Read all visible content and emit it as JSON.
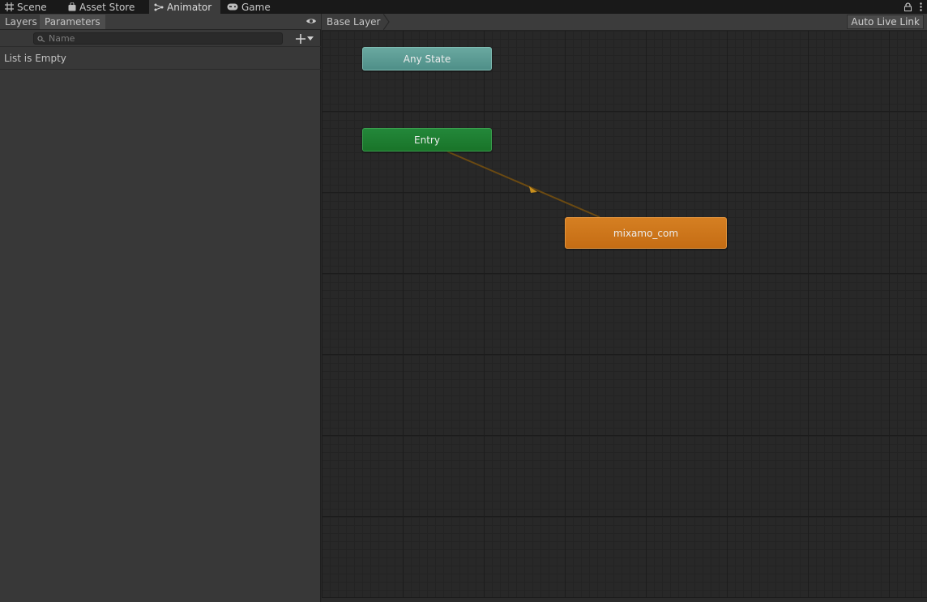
{
  "tabs": [
    {
      "label": "Scene",
      "icon": "grid-icon"
    },
    {
      "label": "Asset Store",
      "icon": "bag-icon"
    },
    {
      "label": "Animator",
      "icon": "animator-icon",
      "active": true
    },
    {
      "label": "Game",
      "icon": "gamepad-icon"
    }
  ],
  "left_panel": {
    "tabs": [
      "Layers",
      "Parameters"
    ],
    "selected_tab": "Parameters",
    "search_placeholder": "Name",
    "empty_text": "List is Empty"
  },
  "graph": {
    "breadcrumb": "Base Layer",
    "live_link_label": "Auto Live Link",
    "nodes": {
      "any_state": "Any State",
      "entry": "Entry",
      "default_state": "mixamo_com"
    }
  },
  "colors": {
    "any_state": "#5c9d95",
    "entry": "#1f7f33",
    "default_state": "#cd761b",
    "transition": "#6b4a12"
  }
}
